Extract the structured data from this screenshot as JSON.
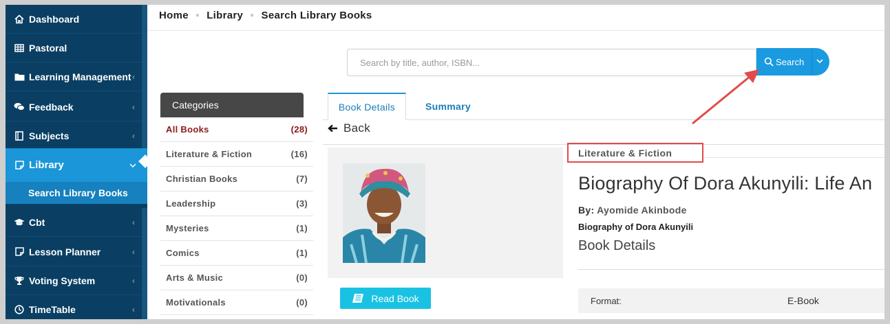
{
  "sidebar": {
    "items": [
      {
        "label": "Dashboard",
        "icon": "home-icon"
      },
      {
        "label": "Pastoral",
        "icon": "table-icon"
      },
      {
        "label": "Learning Management",
        "icon": "folder-icon"
      },
      {
        "label": "Feedback",
        "icon": "comments-icon"
      },
      {
        "label": "Subjects",
        "icon": "book-icon"
      },
      {
        "label": "Library",
        "icon": "note-icon"
      },
      {
        "label": "Cbt",
        "icon": "graduation-cap-icon"
      },
      {
        "label": "Lesson Planner",
        "icon": "note-icon"
      },
      {
        "label": "Voting System",
        "icon": "trophy-icon"
      },
      {
        "label": "TimeTable",
        "icon": "clock-icon"
      }
    ],
    "active_sub": "Search Library Books"
  },
  "breadcrumb": [
    "Home",
    "Library",
    "Search Library Books"
  ],
  "search": {
    "placeholder": "Search by title, author, ISBN...",
    "button_label": "Search"
  },
  "categories": {
    "title": "Categories",
    "items": [
      {
        "name": "All Books",
        "count": "(28)"
      },
      {
        "name": "Literature & Fiction",
        "count": "(16)"
      },
      {
        "name": "Christian Books",
        "count": "(7)"
      },
      {
        "name": "Leadership",
        "count": "(3)"
      },
      {
        "name": "Mysteries",
        "count": "(1)"
      },
      {
        "name": "Comics",
        "count": "(1)"
      },
      {
        "name": "Arts & Music",
        "count": "(0)"
      },
      {
        "name": "Motivationals",
        "count": "(0)"
      }
    ]
  },
  "tabs": [
    "Book Details",
    "Summary"
  ],
  "back_label": "Back",
  "book": {
    "genre": "Literature & Fiction",
    "title": "Biography Of Dora Akunyili: Life An",
    "by_label": "By:",
    "author": "Ayomide Akinbode",
    "subtitle": "Biography of Dora Akunyili",
    "details_heading": "Book Details",
    "read_label": "Read Book",
    "format_key": "Format:",
    "format_value": "E-Book"
  },
  "colors": {
    "sidebar": "#0a3f63",
    "accent": "#1a96d9",
    "annotation": "#e04b4b",
    "read_button": "#19c2e3"
  }
}
